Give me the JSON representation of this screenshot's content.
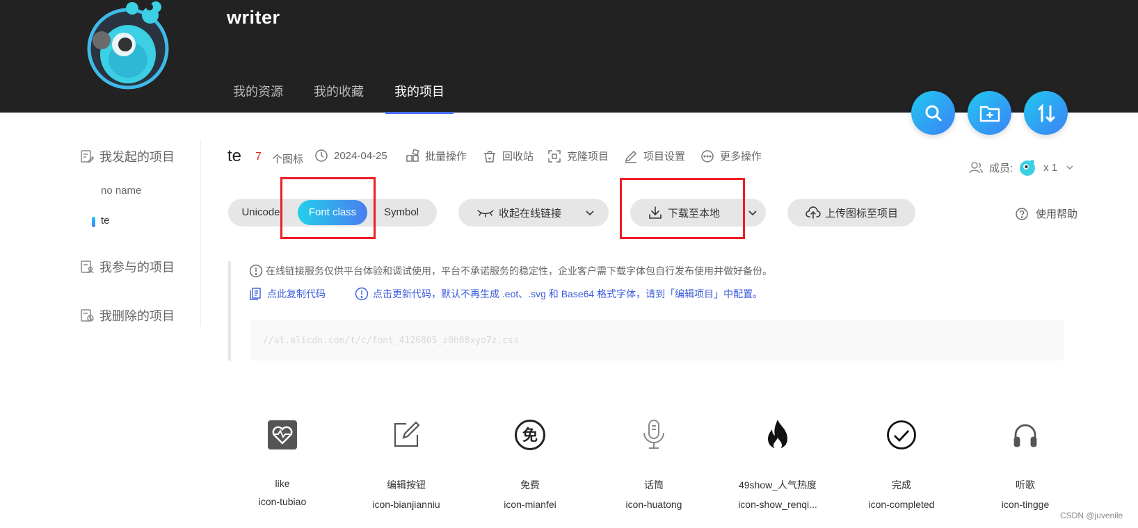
{
  "header": {
    "username": "writer",
    "tabs": [
      {
        "label": "我的资源"
      },
      {
        "label": "我的收藏"
      },
      {
        "label": "我的项目",
        "active": true
      }
    ]
  },
  "fabs": [
    "search-icon",
    "new-folder-icon",
    "sort-icon"
  ],
  "sidebar": {
    "groups": [
      "我发起的项目",
      "我参与的项目",
      "我删除的项目"
    ],
    "items": [
      {
        "label": "no name"
      },
      {
        "label": "te",
        "active": true
      }
    ]
  },
  "project": {
    "title": "te",
    "count": "7",
    "count_label": "个图标",
    "date": "2024-04-25",
    "actions": [
      "批量操作",
      "回收站",
      "克隆项目",
      "项目设置",
      "更多操作"
    ],
    "members_label": "成员:",
    "members_count": "x 1"
  },
  "toolbar": {
    "format_options": [
      "Unicode",
      "Font class",
      "Symbol"
    ],
    "selected_format": "Font class",
    "collapse_label": "收起在线链接",
    "download_label": "下载至本地",
    "upload_label": "上传图标至项目",
    "help_label": "使用帮助"
  },
  "info": {
    "notice": "在线链接服务仅供平台体验和调试使用，平台不承诺服务的稳定性，企业客户需下载字体包自行发布使用并做好备份。",
    "copy_label": "点此复制代码",
    "update_label": "点击更新代码，默认不再生成 .eot、.svg 和 Base64 格式字体，请到「编辑项目」中配置。",
    "code": "//at.alicdn.com/t/c/font_4126805_z0h08xyo7z.css"
  },
  "icons": [
    {
      "name": "like",
      "class": "icon-tubiao",
      "icon": "heart-pulse-icon"
    },
    {
      "name": "编辑按钮",
      "class": "icon-bianjianniu",
      "icon": "edit-icon"
    },
    {
      "name": "免费",
      "class": "icon-mianfei",
      "icon": "free-icon"
    },
    {
      "name": "话筒",
      "class": "icon-huatong",
      "icon": "microphone-icon"
    },
    {
      "name": "49show_人气热度",
      "class": "icon-show_renqi...",
      "icon": "fire-icon"
    },
    {
      "name": "完成",
      "class": "icon-completed",
      "icon": "check-circle-icon"
    },
    {
      "name": "听歌",
      "class": "icon-tingge",
      "icon": "headphones-icon"
    }
  ],
  "colors": {
    "header_bg": "#222222",
    "accent_start": "#22c8f0",
    "accent_end": "#3b82f6",
    "link": "#3b5bdb",
    "count": "#e02424",
    "highlight_box": "#ee1c24"
  },
  "watermark": "CSDN @juvenile"
}
